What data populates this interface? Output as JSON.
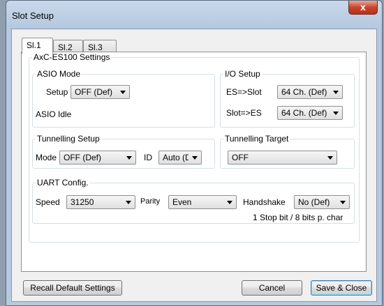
{
  "window": {
    "title": "Slot Setup",
    "close_glyph": "x"
  },
  "tabs": [
    {
      "label": "Sl.1",
      "active": true
    },
    {
      "label": "Sl.2",
      "active": false
    },
    {
      "label": "Sl.3",
      "active": false
    }
  ],
  "group_title": "AxC-ES100 Settings",
  "asio": {
    "legend": "ASIO Mode",
    "setup_label": "Setup",
    "setup_value": "OFF (Def)",
    "status": "ASIO Idle"
  },
  "io": {
    "legend": "I/O Setup",
    "es_slot_label": "ES=>Slot",
    "es_slot_value": "64 Ch. (Def)",
    "slot_es_label": "Slot=>ES",
    "slot_es_value": "64 Ch. (Def)"
  },
  "tunnelling": {
    "legend": "Tunnelling Setup",
    "mode_label": "Mode",
    "mode_value": "OFF (Def)",
    "id_label": "ID",
    "id_value": "Auto (D"
  },
  "target": {
    "legend": "Tunnelling Target",
    "value": "OFF"
  },
  "uart": {
    "legend": "UART Config.",
    "speed_label": "Speed",
    "speed_value": "31250",
    "parity_label": "Parity",
    "parity_value": "Even",
    "handshake_label": "Handshake",
    "handshake_value": "No (Def)",
    "note": "1 Stop bit / 8 bits p. char"
  },
  "buttons": {
    "recall": "Recall Default Settings",
    "cancel": "Cancel",
    "save": "Save & Close"
  },
  "colors": {
    "close_button": "#c9442c",
    "title_bar": "#b6c9df"
  }
}
